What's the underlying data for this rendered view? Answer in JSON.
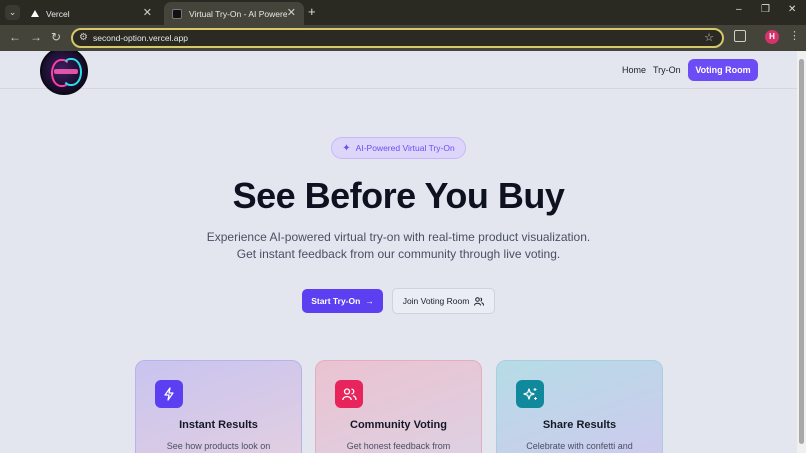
{
  "browser": {
    "tabs": [
      {
        "title": "Vercel",
        "favicon": "vercel-triangle-icon"
      },
      {
        "title": "Virtual Try-On - AI Powered",
        "favicon": "app-favicon-icon",
        "active": true
      }
    ],
    "new_tab_glyph": "+",
    "url": "second-option.vercel.app",
    "profile_initial": "H",
    "window_controls": {
      "minimize": "–",
      "restore": "❐",
      "close": "✕"
    },
    "accent_color": "#d7c86a"
  },
  "header": {
    "nav": {
      "home": "Home",
      "tryon": "Try-On",
      "voting_room": "Voting Room"
    },
    "cta_color": "#6c4df5"
  },
  "hero": {
    "badge": "AI-Powered Virtual Try-On",
    "title": "See Before You Buy",
    "subtitle_line1": "Experience AI-powered virtual try-on with real-time product visualization.",
    "subtitle_line2": "Get instant feedback from our community through live voting.",
    "primary_button": "Start Try-On",
    "secondary_button": "Join Voting Room"
  },
  "features": [
    {
      "title": "Instant Results",
      "desc": "See how products look on",
      "icon": "lightning-icon",
      "color": "#5b3ff0"
    },
    {
      "title": "Community Voting",
      "desc": "Get honest feedback from",
      "icon": "users-icon",
      "color": "#e8245c"
    },
    {
      "title": "Share Results",
      "desc": "Celebrate with confetti and",
      "icon": "sparkles-icon",
      "color": "#11899c"
    }
  ]
}
